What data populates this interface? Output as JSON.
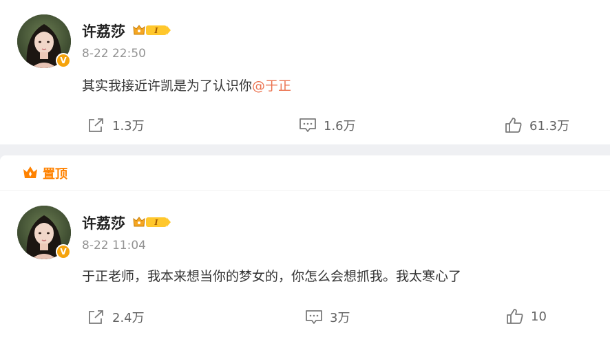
{
  "posts": [
    {
      "username": "许荔莎",
      "rank": "I",
      "time": "8-22 22:50",
      "text": "其实我接近许凯是为了认识你",
      "mention": "@于正",
      "share": "1.3万",
      "comment": "1.6万",
      "like": "61.3万"
    },
    {
      "pinned_label": "置顶",
      "username": "许荔莎",
      "rank": "I",
      "time": "8-22 11:04",
      "text": "于正老师，我本来想当你的梦女的，你怎么会想抓我。我太寒心了",
      "share": "2.4万",
      "comment": "3万",
      "like": "10"
    }
  ],
  "icons": {
    "share": "share-icon",
    "comment": "comment-icon",
    "like": "thumbs-up-icon",
    "verified": "verified-v-badge",
    "pin": "crown-icon"
  },
  "colors": {
    "accent_orange": "#ff8200",
    "mention": "#eb7350",
    "verified": "#f5a30c",
    "meta_gray": "#939393"
  }
}
